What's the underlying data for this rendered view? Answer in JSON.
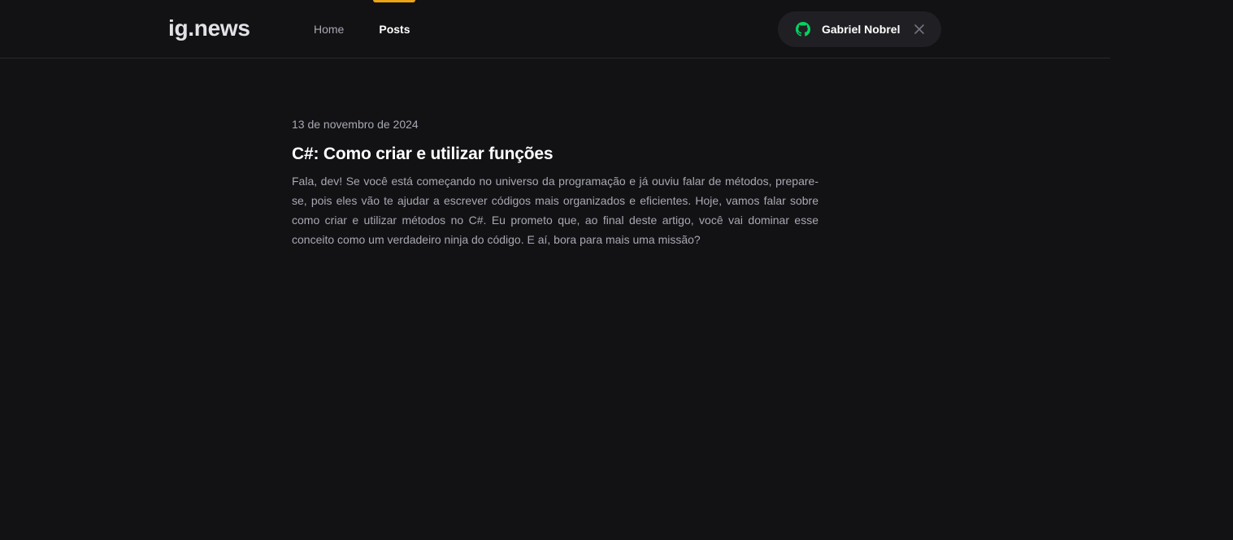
{
  "header": {
    "logo": "ig.news",
    "nav": [
      {
        "label": "Home",
        "active": false
      },
      {
        "label": "Posts",
        "active": true
      }
    ],
    "user": {
      "name": "Gabriel Nobrel",
      "github_icon": "github-icon",
      "close_icon": "close-icon"
    }
  },
  "colors": {
    "background": "#121214",
    "header_border": "#29292e",
    "accent": "#eba417",
    "github_green": "#04d361",
    "user_button_bg": "#202024",
    "muted_text": "#a8a8b3",
    "white": "#ffffff"
  },
  "posts": [
    {
      "date": "13 de novembro de 2024",
      "title": "C#: Como criar e utilizar funções",
      "excerpt": "Fala, dev! Se você está começando no universo da programação e já ouviu falar de métodos, prepare-se, pois eles vão te ajudar a escrever códigos mais organizados e eficientes. Hoje, vamos falar sobre como criar e utilizar métodos no C#. Eu prometo que, ao final deste artigo, você vai dominar esse conceito como um verdadeiro ninja do código. E aí, bora para mais uma missão?"
    }
  ]
}
